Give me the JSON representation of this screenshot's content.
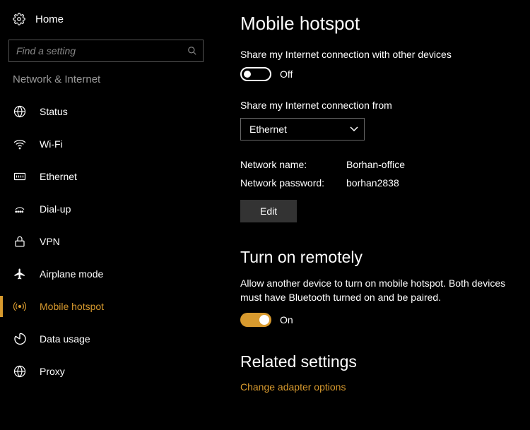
{
  "home_label": "Home",
  "search_placeholder": "Find a setting",
  "category": "Network & Internet",
  "sidebar": {
    "items": [
      {
        "label": "Status"
      },
      {
        "label": "Wi-Fi"
      },
      {
        "label": "Ethernet"
      },
      {
        "label": "Dial-up"
      },
      {
        "label": "VPN"
      },
      {
        "label": "Airplane mode"
      },
      {
        "label": "Mobile hotspot"
      },
      {
        "label": "Data usage"
      },
      {
        "label": "Proxy"
      }
    ]
  },
  "main": {
    "title": "Mobile hotspot",
    "share_desc": "Share my Internet connection with other devices",
    "share_toggle_state": "Off",
    "share_from_label": "Share my Internet connection from",
    "share_from_value": "Ethernet",
    "net_name_label": "Network name:",
    "net_name_value": "Borhan-office",
    "net_pass_label": "Network password:",
    "net_pass_value": "borhan2838",
    "edit_label": "Edit",
    "remote_title": "Turn on remotely",
    "remote_desc": "Allow another device to turn on mobile hotspot. Both devices must have Bluetooth turned on and be paired.",
    "remote_toggle_state": "On",
    "related_title": "Related settings",
    "related_link": "Change adapter options"
  }
}
